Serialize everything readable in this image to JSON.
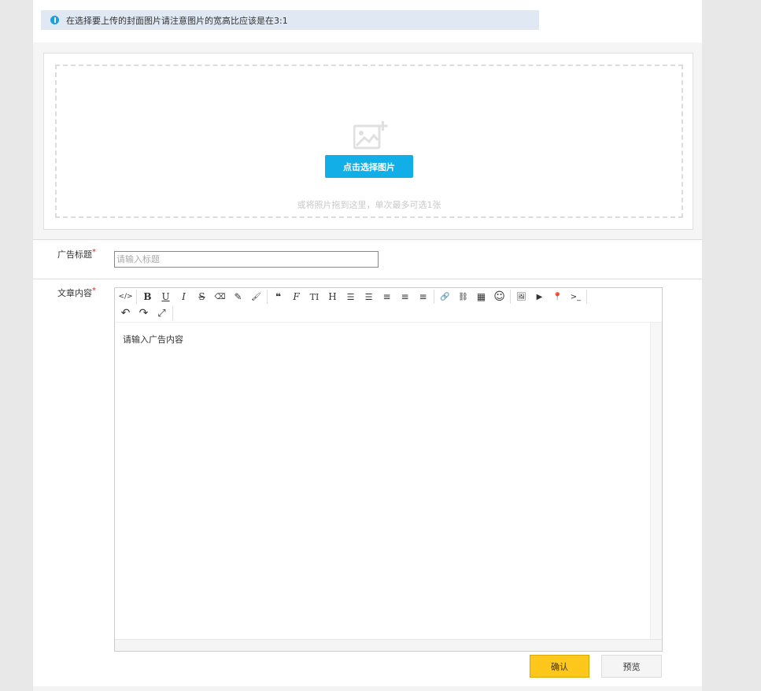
{
  "notice": {
    "text": "在选择要上传的封面图片请注意图片的宽高比应该是在3:1",
    "icon": "info-icon"
  },
  "upload": {
    "icon": "image-add-icon",
    "button_label": "点击选择图片",
    "hint": "或将照片拖到这里，单次最多可选1张"
  },
  "form": {
    "title_label": "广告标题",
    "title_placeholder": "请输入标题",
    "title_value": "",
    "content_label": "文章内容",
    "required_mark": "*"
  },
  "editor": {
    "toolbar": [
      {
        "name": "code-view-icon",
        "glyph": "</>"
      },
      {
        "name": "bold-icon",
        "glyph": "B"
      },
      {
        "name": "underline-icon",
        "glyph": "U"
      },
      {
        "name": "italic-icon",
        "glyph": "I"
      },
      {
        "name": "strikethrough-icon",
        "glyph": "S"
      },
      {
        "name": "eraser-icon",
        "glyph": "⌫"
      },
      {
        "name": "pencil-icon",
        "glyph": "✎"
      },
      {
        "name": "brush-icon",
        "glyph": "🖌"
      },
      {
        "name": "quote-icon",
        "glyph": "❝"
      },
      {
        "name": "font-family-icon",
        "glyph": "F"
      },
      {
        "name": "font-size-icon",
        "glyph": "TI"
      },
      {
        "name": "heading-icon",
        "glyph": "H"
      },
      {
        "name": "unordered-list-icon",
        "glyph": "☰"
      },
      {
        "name": "ordered-list-icon",
        "glyph": "☰"
      },
      {
        "name": "align-left-icon",
        "glyph": "≡"
      },
      {
        "name": "align-center-icon",
        "glyph": "≡"
      },
      {
        "name": "align-right-icon",
        "glyph": "≡"
      },
      {
        "name": "link-icon",
        "glyph": "🔗"
      },
      {
        "name": "unlink-icon",
        "glyph": "⛓"
      },
      {
        "name": "table-icon",
        "glyph": "▦"
      },
      {
        "name": "emoji-icon",
        "glyph": "☺"
      },
      {
        "name": "image-icon",
        "glyph": "🖼"
      },
      {
        "name": "video-icon",
        "glyph": "▶"
      },
      {
        "name": "map-marker-icon",
        "glyph": "📍"
      },
      {
        "name": "terminal-icon",
        "glyph": ">_"
      },
      {
        "name": "undo-icon",
        "glyph": "↶"
      },
      {
        "name": "redo-icon",
        "glyph": "↷"
      },
      {
        "name": "fullscreen-icon",
        "glyph": "⤢"
      }
    ],
    "content": "请输入广告内容"
  },
  "actions": {
    "confirm_label": "确认",
    "preview_label": "预览"
  },
  "colors": {
    "primary": "#11aee8",
    "confirm": "#fdc71c",
    "required": "#e02020",
    "notice_bg": "#dfe8f3"
  }
}
